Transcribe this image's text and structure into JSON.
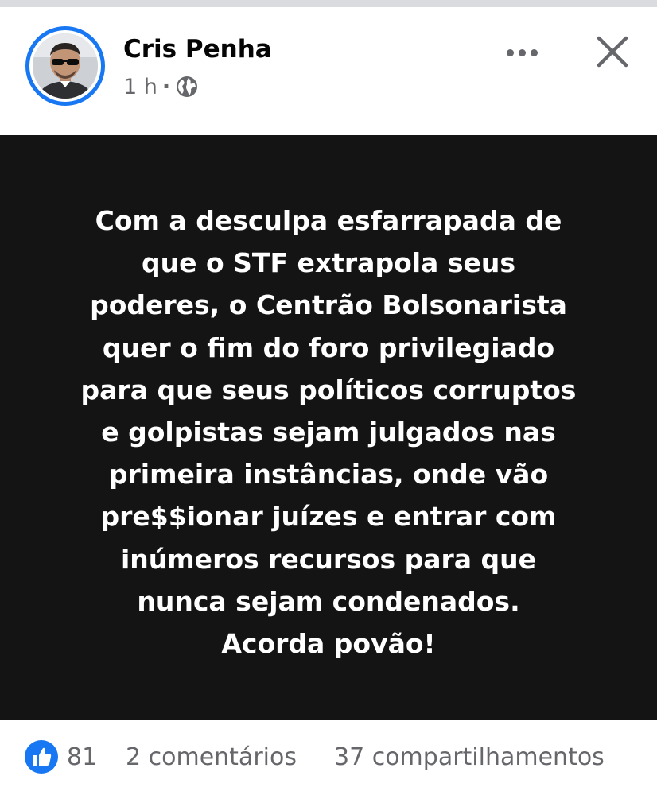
{
  "post": {
    "author": "Cris Penha",
    "time": "1 h",
    "separator": "·",
    "audience_icon": "globe-icon",
    "text_lines": [
      "Com a desculpa esfarrapada de",
      "que o STF extrapola seus",
      "poderes, o Centrão Bolsonarista",
      "quer o fim do foro privilegiado",
      "para que seus políticos corruptos",
      "e golpistas sejam julgados nas",
      "primeira instâncias, onde vão",
      "pre$$ionar juízes e entrar com",
      "inúmeros recursos para que",
      "nunca sejam condenados.",
      "Acorda povão!"
    ],
    "background_color": "#141414",
    "text_color": "#ffffff"
  },
  "stats": {
    "reactions": "81",
    "comments": "2 comentários",
    "shares": "37 compartilhamentos"
  },
  "icons": {
    "more": "more-options-icon",
    "close": "close-icon",
    "like": "like-icon"
  },
  "colors": {
    "accent": "#1877f2",
    "secondary_text": "#65676b",
    "primary_text": "#050505"
  }
}
